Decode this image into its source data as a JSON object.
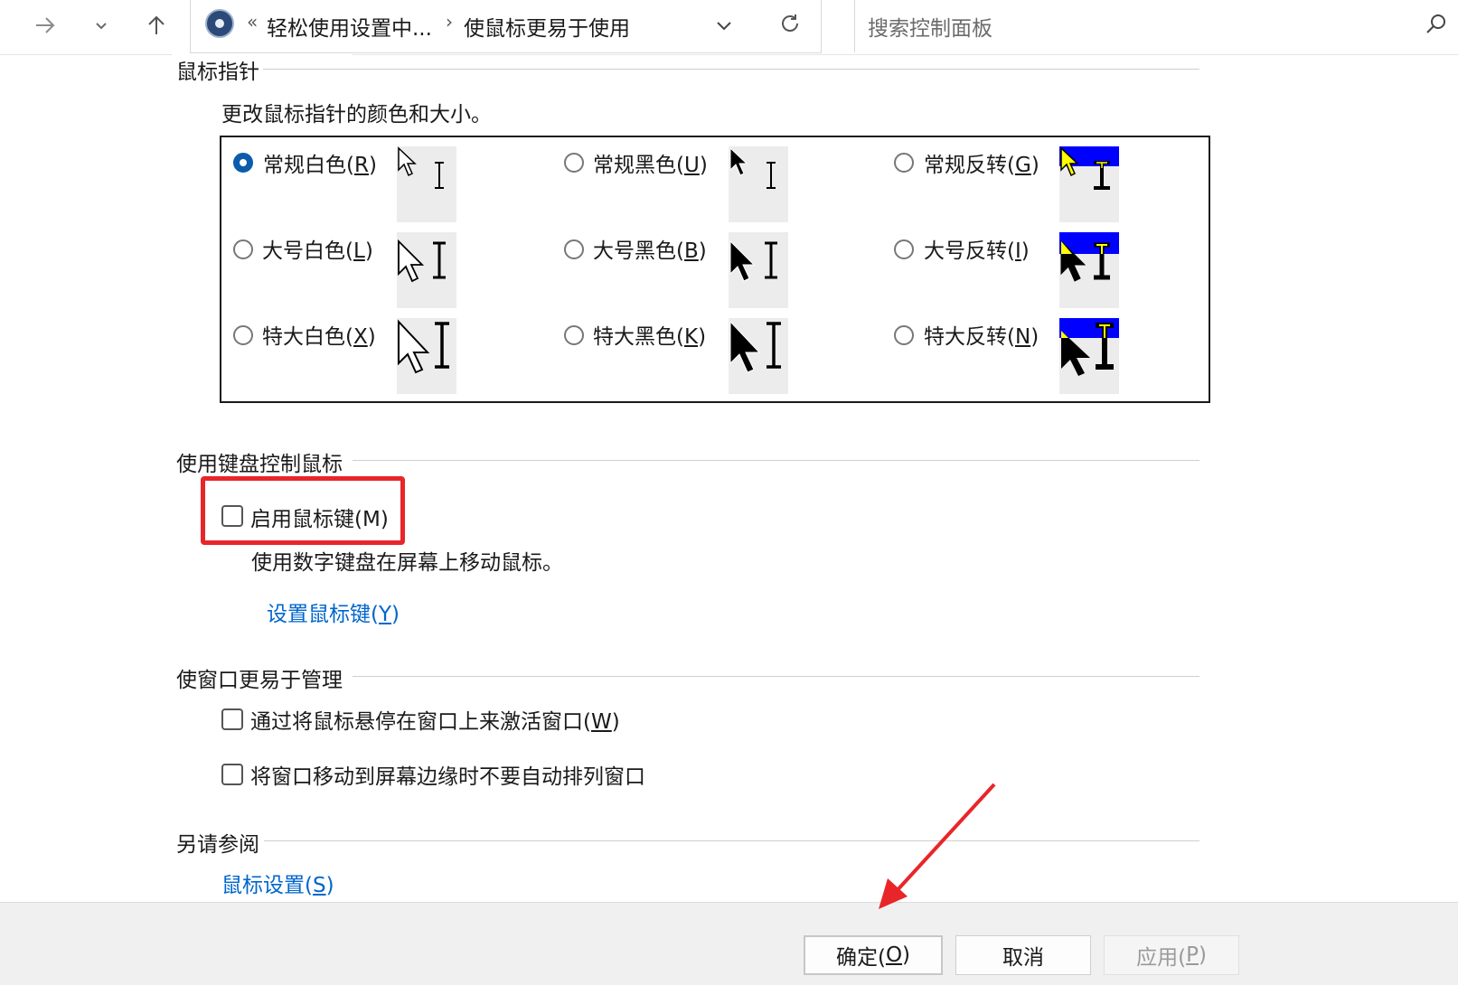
{
  "nav": {
    "breadcrumb_overflow": "«",
    "breadcrumb_parent": "轻松使用设置中...",
    "breadcrumb_sep": "›",
    "breadcrumb_current": "使鼠标更易于使用",
    "search_placeholder": "搜索控制面板"
  },
  "pointers": {
    "section_title": "鼠标指针",
    "description": "更改鼠标指针的颜色和大小。",
    "options": [
      {
        "text": "常规白色(",
        "key": "R",
        "end": ")",
        "selected": true
      },
      {
        "text": "常规黑色(",
        "key": "U",
        "end": ")",
        "selected": false
      },
      {
        "text": "常规反转(",
        "key": "G",
        "end": ")",
        "selected": false
      },
      {
        "text": "大号白色(",
        "key": "L",
        "end": ")",
        "selected": false
      },
      {
        "text": "大号黑色(",
        "key": "B",
        "end": ")",
        "selected": false
      },
      {
        "text": "大号反转(",
        "key": "I",
        "end": ")",
        "selected": false
      },
      {
        "text": "特大白色(",
        "key": "X",
        "end": ")",
        "selected": false
      },
      {
        "text": "特大黑色(",
        "key": "K",
        "end": ")",
        "selected": false
      },
      {
        "text": "特大反转(",
        "key": "N",
        "end": ")",
        "selected": false
      }
    ]
  },
  "keyboard": {
    "section_title": "使用键盘控制鼠标",
    "enable_mousekeys": "启用鼠标键(M)",
    "enable_checked": false,
    "description": "使用数字键盘在屏幕上移动鼠标。",
    "setup_link_text": "设置鼠标键(",
    "setup_link_key": "Y",
    "setup_link_end": ")"
  },
  "windows": {
    "section_title": "使窗口更易于管理",
    "hover_activate_text": "通过将鼠标悬停在窗口上来激活窗口(",
    "hover_activate_key": "W",
    "hover_activate_end": ")",
    "no_snap": "将窗口移动到屏幕边缘时不要自动排列窗口"
  },
  "see_also": {
    "section_title": "另请参阅",
    "mouse_settings_text": "鼠标设置(",
    "mouse_settings_key": "S",
    "mouse_settings_end": ")"
  },
  "buttons": {
    "ok_text": "确定(",
    "ok_key": "O",
    "ok_end": ")",
    "cancel": "取消",
    "apply_text": "应用(",
    "apply_key": "P",
    "apply_end": ")"
  },
  "colors": {
    "accent": "#0066cc",
    "annotation_red": "#e8262a",
    "inverted_blue": "#0000ff",
    "inverted_yellow": "#ffff00"
  }
}
